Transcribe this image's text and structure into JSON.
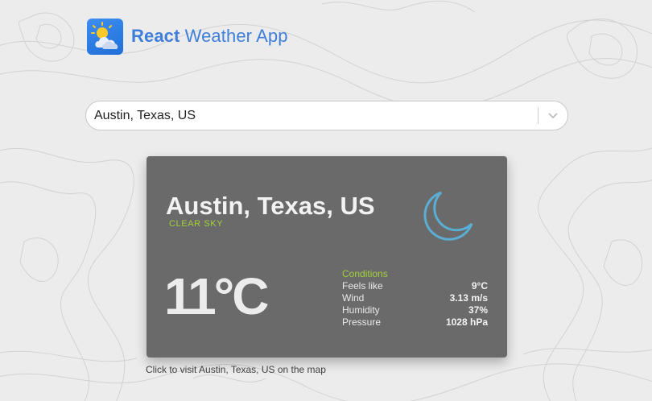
{
  "app": {
    "title_bold": "React",
    "title_rest": " Weather App",
    "logo_icon": "sun-behind-cloud-icon"
  },
  "search": {
    "value": "Austin, Texas, US",
    "dropdown_icon": "chevron-down-icon"
  },
  "weather": {
    "city": "Austin, Texas, US",
    "description": "CLEAR SKY",
    "icon": "crescent-moon-icon",
    "temperature": "11°C",
    "conditions_heading": "Conditions",
    "details": [
      {
        "label": "Feels like",
        "value": "9°C"
      },
      {
        "label": "Wind",
        "value": "3.13 m/s"
      },
      {
        "label": "Humidity",
        "value": "37%"
      },
      {
        "label": "Pressure",
        "value": "1028 hPa"
      }
    ]
  },
  "map_link": "Click to visit Austin, Texas, US on the map",
  "colors": {
    "accent_title": "#3f7ed9",
    "card_background": "#6a6a6a",
    "condition_green": "#a3cf3c",
    "moon_blue": "#5aaed3"
  }
}
